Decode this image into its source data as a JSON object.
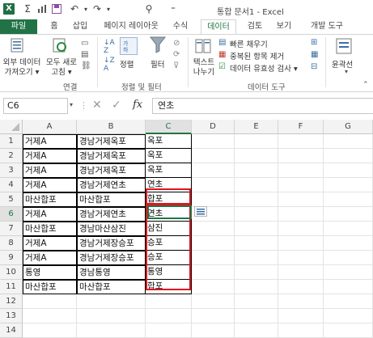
{
  "window": {
    "title": "통합 문서1 - Excel",
    "app_icon": "X",
    "qat_icons": [
      "excel-icon",
      "sum-icon",
      "bar-chart-icon",
      "save-icon",
      "undo-icon",
      "redo-icon",
      "customize-icon"
    ]
  },
  "tabs": [
    {
      "label": "파일",
      "active": false,
      "accent": "#217346"
    },
    {
      "label": "홈"
    },
    {
      "label": "삽입"
    },
    {
      "label": "페이지 레이아웃"
    },
    {
      "label": "수식"
    },
    {
      "label": "데이터",
      "active": true
    },
    {
      "label": "검토"
    },
    {
      "label": "보기"
    },
    {
      "label": "개발 도구"
    }
  ],
  "ribbon": {
    "external_data": "외부 데이터\n가져오기 ▾",
    "refresh_all": "모두 새로\n고침 ▾",
    "connections_group": "연결",
    "sort": "정렬",
    "filter": "필터",
    "sort_filter_group": "정렬 및 필터",
    "text_to_columns": "텍스트\n나누기",
    "flash_fill": "빠른 채우기",
    "remove_duplicates": "중복된 항목 제거",
    "data_validation": "데이터 유효성 검사 ▾",
    "data_tools_group": "데이터 도구",
    "outline": "윤곽선"
  },
  "formula_bar": {
    "name_box": "C6",
    "fx": "fx",
    "value": "연초"
  },
  "grid": {
    "columns": [
      "A",
      "B",
      "C",
      "D",
      "E",
      "F",
      "G"
    ],
    "rows": [
      "1",
      "2",
      "3",
      "4",
      "5",
      "6",
      "7",
      "8",
      "9",
      "10",
      "11",
      "12",
      "13",
      "14"
    ],
    "data": [
      [
        "거제A",
        "경남거제옥포",
        "옥포"
      ],
      [
        "거제A",
        "경남거제옥포",
        "옥포"
      ],
      [
        "거제A",
        "경남거제옥포",
        "옥포"
      ],
      [
        "거제A",
        "경남거제연초",
        "연초"
      ],
      [
        "마산합포",
        "마산합포",
        "합포"
      ],
      [
        "거제A",
        "경남거제연초",
        "연초"
      ],
      [
        "마산합포",
        "경남마산삼진",
        "삼진"
      ],
      [
        "거제A",
        "경남거제장승포",
        "승포"
      ],
      [
        "거제A",
        "경남거제장승포",
        "승포"
      ],
      [
        "통영",
        "경남통영",
        "통영"
      ],
      [
        "마산합포",
        "마산합포",
        "합포"
      ]
    ],
    "selected_cell": "C6",
    "highlight_color": "#e0141e",
    "selection_color": "#217346"
  }
}
